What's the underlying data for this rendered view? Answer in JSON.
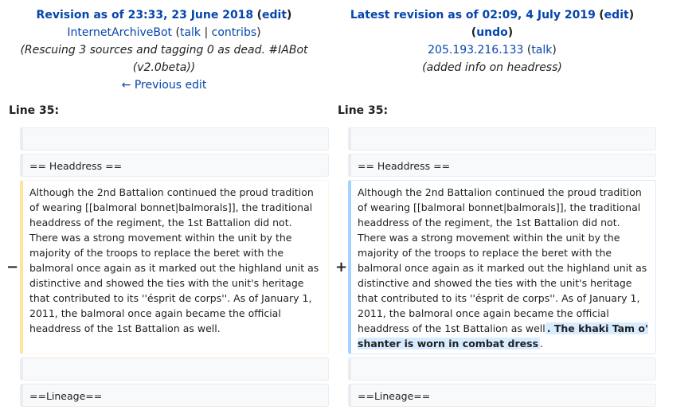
{
  "left_header": {
    "title": "Revision as of 23:33, 23 June 2018",
    "edit": "edit",
    "user": "InternetArchiveBot",
    "talk": "talk",
    "contribs": "contribs",
    "summary": "(Rescuing 3 sources and tagging 0 as dead. #IABot",
    "summary2": "(v2.0beta))",
    "prev": "← Previous edit"
  },
  "right_header": {
    "title": "Latest revision as of 02:09, 4 July 2019",
    "edit": "edit",
    "undo": "undo",
    "user": "205.193.216.133",
    "talk": "talk",
    "summary": "(added info on headress)"
  },
  "line_label_left": "Line 35:",
  "line_label_right": "Line 35:",
  "rows": {
    "headdress": "== Headdress ==",
    "lineage": "==Lineage==",
    "para_left": "Although the 2nd Battalion continued the proud tradition of wearing [[balmoral bonnet|balmorals]], the traditional headdress of the regiment, the 1st Battalion did not. There was a strong movement within the unit by the majority of the troops to replace the beret with the balmoral once again as it marked out the highland unit as distinctive and showed the ties with the unit's heritage that contributed to its ''ésprit de corps''. As of January 1, 2011, the balmoral once again became the official headdress of the 1st Battalion as well.",
    "para_right_base": "Although the 2nd Battalion continued the proud tradition of wearing [[balmoral bonnet|balmorals]], the traditional headdress of the regiment, the 1st Battalion did not. There was a strong movement within the unit by the majority of the troops to replace the beret with the balmoral once again as it marked out the highland unit as distinctive and showed the ties with the unit's heritage that contributed to its ''ésprit de corps''. As of January 1, 2011, the balmoral once again became the official headdress of the 1st Battalion as well",
    "para_right_added": ". The khaki Tam o' shanter is worn in combat dress",
    "para_right_end": "."
  },
  "markers": {
    "minus": "−",
    "plus": "+"
  }
}
